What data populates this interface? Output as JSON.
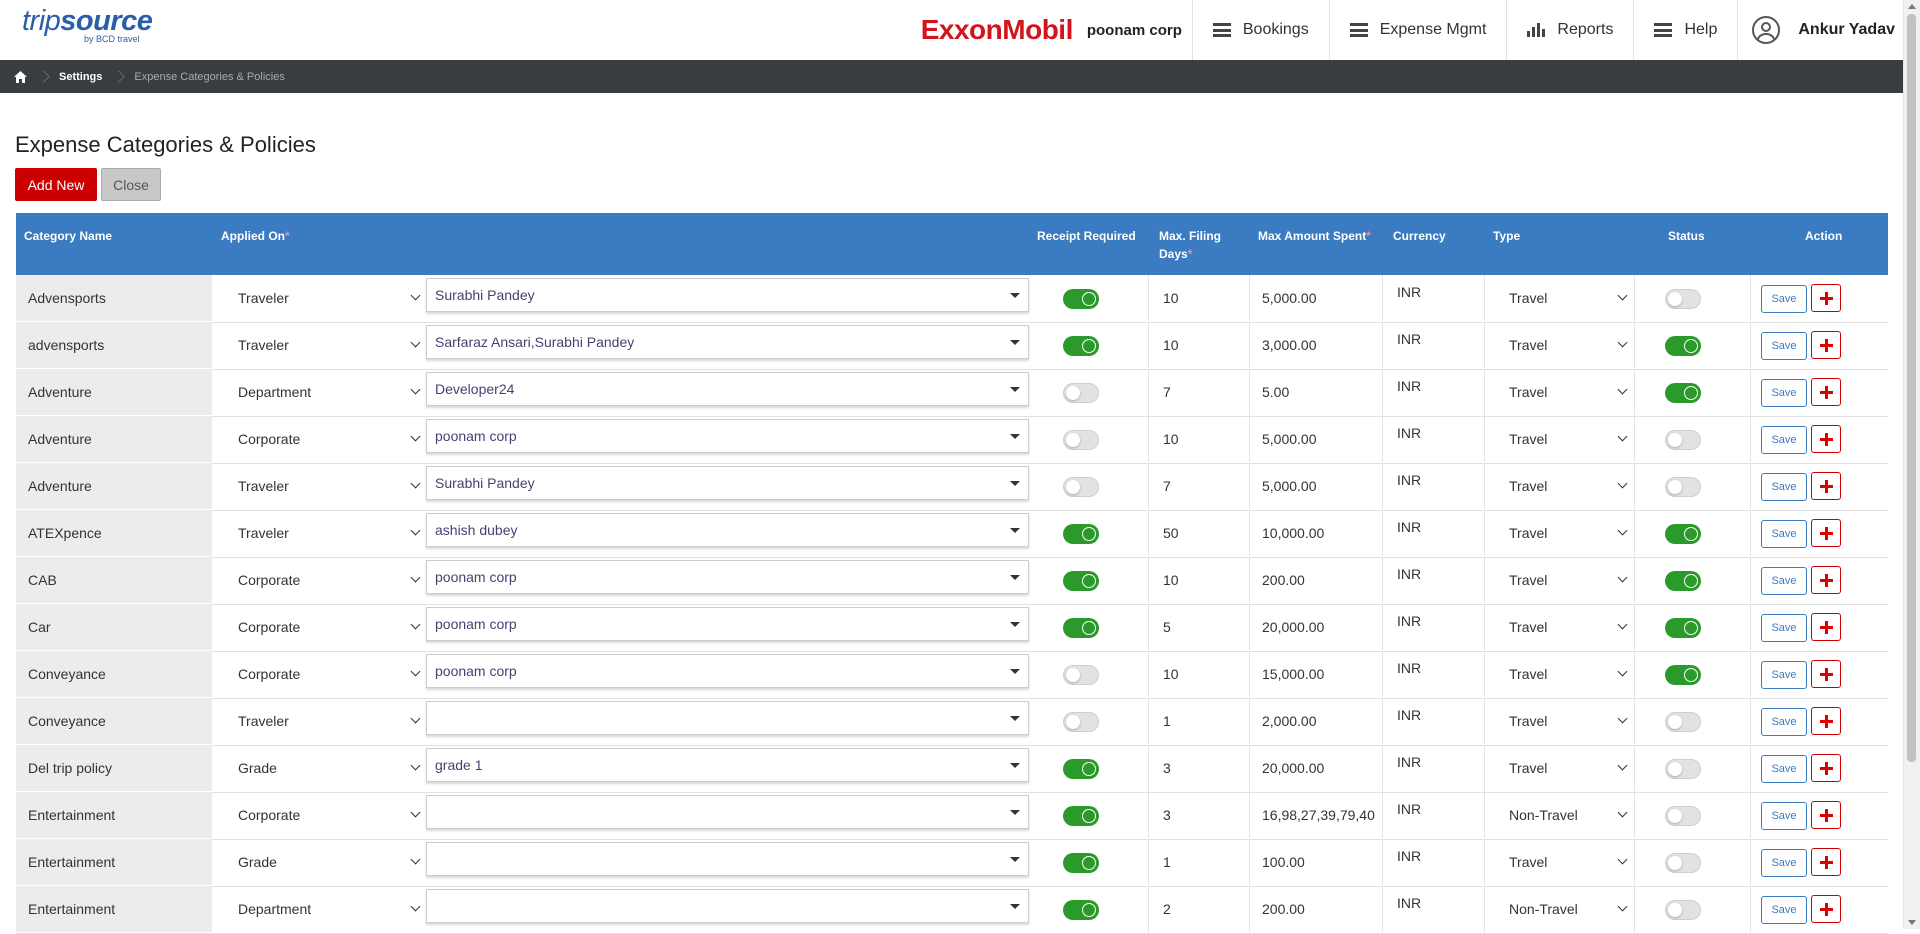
{
  "header": {
    "logo_text_light": "trip",
    "logo_text_bold": "source",
    "logo_sub": "by BCD travel",
    "partner_logo": "ExxonMobil",
    "corp_name": "poonam corp",
    "nav": [
      {
        "label": "Bookings",
        "icon": "menu-icon"
      },
      {
        "label": "Expense Mgmt",
        "icon": "menu-icon"
      },
      {
        "label": "Reports",
        "icon": "bar-chart-icon"
      },
      {
        "label": "Help",
        "icon": "menu-icon"
      }
    ],
    "user_name": "Ankur Yadav"
  },
  "breadcrumb": {
    "items": [
      "Settings"
    ],
    "current": "Expense Categories & Policies"
  },
  "page": {
    "title": "Expense Categories & Policies",
    "add_new_label": "Add New",
    "close_label": "Close"
  },
  "table": {
    "columns": {
      "category": "Category Name",
      "applied_on": "Applied On",
      "receipt": "Receipt Required",
      "max_filing_line1": "Max. Filing",
      "max_filing_line2": "Days",
      "max_amount": "Max Amount Spent",
      "currency": "Currency",
      "type": "Type",
      "status": "Status",
      "action": "Action"
    },
    "save_label": "Save",
    "rows": [
      {
        "name": "Advensports",
        "applied_on": "Traveler",
        "applied_to": "Surabhi Pandey",
        "receipt": true,
        "days": "10",
        "amount": "5,000.00",
        "currency": "INR",
        "type": "Travel",
        "status": false
      },
      {
        "name": "advensports",
        "applied_on": "Traveler",
        "applied_to": "Sarfaraz Ansari,Surabhi Pandey",
        "receipt": true,
        "days": "10",
        "amount": "3,000.00",
        "currency": "INR",
        "type": "Travel",
        "status": true
      },
      {
        "name": "Adventure",
        "applied_on": "Department",
        "applied_to": "Developer24",
        "receipt": false,
        "days": "7",
        "amount": "5.00",
        "currency": "INR",
        "type": "Travel",
        "status": true
      },
      {
        "name": "Adventure",
        "applied_on": "Corporate",
        "applied_to": "poonam corp",
        "receipt": false,
        "days": "10",
        "amount": "5,000.00",
        "currency": "INR",
        "type": "Travel",
        "status": false
      },
      {
        "name": "Adventure",
        "applied_on": "Traveler",
        "applied_to": "Surabhi Pandey",
        "receipt": false,
        "days": "7",
        "amount": "5,000.00",
        "currency": "INR",
        "type": "Travel",
        "status": false
      },
      {
        "name": "ATEXpence",
        "applied_on": "Traveler",
        "applied_to": "ashish dubey",
        "receipt": true,
        "days": "50",
        "amount": "10,000.00",
        "currency": "INR",
        "type": "Travel",
        "status": true
      },
      {
        "name": "CAB",
        "applied_on": "Corporate",
        "applied_to": "poonam corp",
        "receipt": true,
        "days": "10",
        "amount": "200.00",
        "currency": "INR",
        "type": "Travel",
        "status": true
      },
      {
        "name": "Car",
        "applied_on": "Corporate",
        "applied_to": "poonam corp",
        "receipt": true,
        "days": "5",
        "amount": "20,000.00",
        "currency": "INR",
        "type": "Travel",
        "status": true
      },
      {
        "name": "Conveyance",
        "applied_on": "Corporate",
        "applied_to": "poonam corp",
        "receipt": false,
        "days": "10",
        "amount": "15,000.00",
        "currency": "INR",
        "type": "Travel",
        "status": true
      },
      {
        "name": "Conveyance",
        "applied_on": "Traveler",
        "applied_to": "",
        "receipt": false,
        "days": "1",
        "amount": "2,000.00",
        "currency": "INR",
        "type": "Travel",
        "status": false
      },
      {
        "name": "Del trip policy",
        "applied_on": "Grade",
        "applied_to": "grade 1",
        "receipt": true,
        "days": "3",
        "amount": "20,000.00",
        "currency": "INR",
        "type": "Travel",
        "status": false
      },
      {
        "name": "Entertainment",
        "applied_on": "Corporate",
        "applied_to": "",
        "receipt": true,
        "days": "3",
        "amount": "16,98,27,39,79,40",
        "currency": "INR",
        "type": "Non-Travel",
        "status": false
      },
      {
        "name": "Entertainment",
        "applied_on": "Grade",
        "applied_to": "",
        "receipt": true,
        "days": "1",
        "amount": "100.00",
        "currency": "INR",
        "type": "Travel",
        "status": false
      },
      {
        "name": "Entertainment",
        "applied_on": "Department",
        "applied_to": "",
        "receipt": true,
        "days": "2",
        "amount": "200.00",
        "currency": "INR",
        "type": "Non-Travel",
        "status": false
      }
    ]
  },
  "colors": {
    "accent": "#3a7bc1",
    "brand_red": "#cc0000",
    "toggle_on": "#2a9a2a",
    "breadcrumb_bg": "#3a3d40"
  }
}
